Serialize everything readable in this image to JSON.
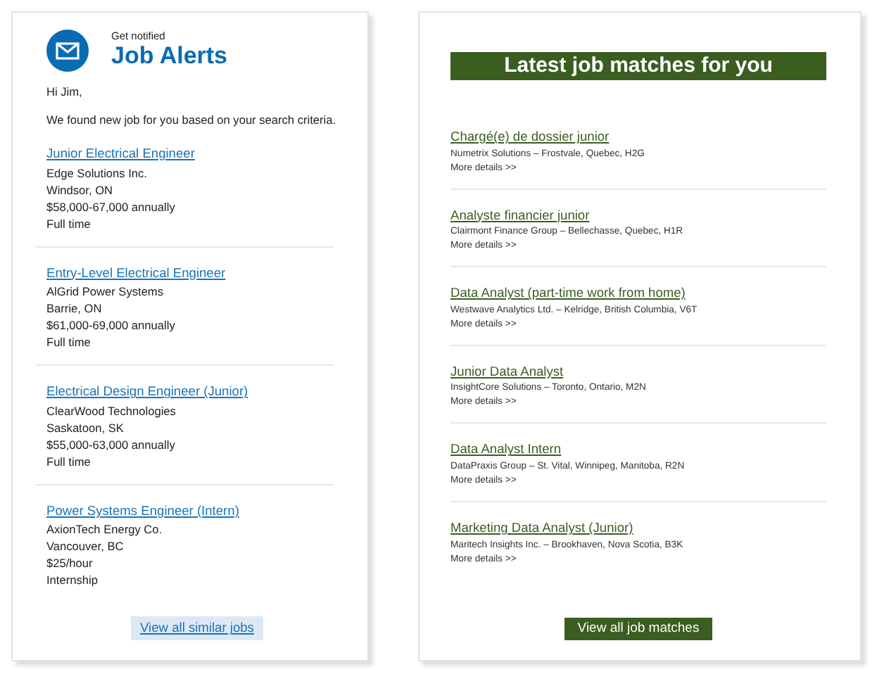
{
  "alerts": {
    "eyebrow": "Get notified",
    "title": "Job Alerts",
    "greeting": "Hi Jim,",
    "intro": "We found new job for you based on your search criteria.",
    "jobs": [
      {
        "title": "Junior Electrical Engineer",
        "lines": [
          "Edge Solutions Inc.",
          "Windsor, ON",
          "$58,000-67,000 annually",
          "Full time"
        ]
      },
      {
        "title": "Entry-Level Electrical Engineer",
        "lines": [
          "AlGrid Power Systems",
          "Barrie, ON",
          "$61,000-69,000 annually",
          "Full time"
        ]
      },
      {
        "title": "Electrical Design Engineer (Junior)",
        "lines": [
          "ClearWood Technologies",
          "Saskatoon, SK",
          "$55,000-63,000 annually",
          "Full time"
        ]
      },
      {
        "title": "Power Systems Engineer (Intern)",
        "lines": [
          "AxionTech Energy Co.",
          "Vancouver, BC",
          "$25/hour",
          "Internship"
        ]
      }
    ],
    "button": "View all similar jobs"
  },
  "matches": {
    "title": "Latest job matches for you",
    "jobs": [
      {
        "title": "Chargé(e) de dossier junior",
        "company": "Numetrix Solutions – Frostvale, Quebec, H2G",
        "more": "More details >>"
      },
      {
        "title": "Analyste financier junior",
        "company": "Clairmont Finance Group – Bellechasse, Quebec, H1R",
        "more": "More details >>"
      },
      {
        "title": "Data Analyst (part-time work from home)",
        "company": "Westwave Analytics Ltd. – Kelridge, British Columbia, V6T",
        "more": "More details >>"
      },
      {
        "title": "Junior Data Analyst",
        "company": "InsightCore Solutions – Toronto, Ontario, M2N",
        "more": "More details >>"
      },
      {
        "title": "Data Analyst Intern",
        "company": "DataPraxis Group – St. Vital, Winnipeg, Manitoba, R2N",
        "more": "More details >>"
      },
      {
        "title": "Marketing Data Analyst (Junior)",
        "company": "Maritech Insights Inc. – Brookhaven, Nova Scotia, B3K",
        "more": "More details >>"
      }
    ],
    "button": "View all job matches"
  }
}
